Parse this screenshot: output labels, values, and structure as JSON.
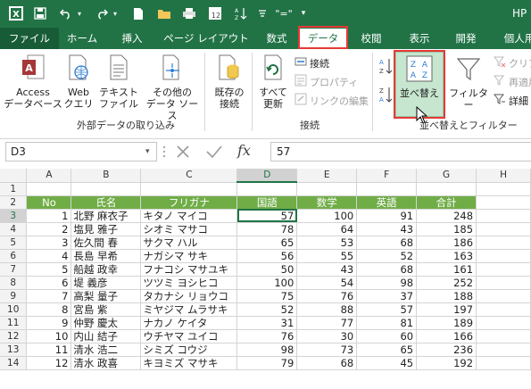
{
  "titlebar": {
    "title": "HP",
    "colors": {
      "brand": "#217346",
      "file_tab": "#185c37",
      "highlight": "#e53935"
    },
    "icons": [
      "excel-icon",
      "save-icon",
      "undo-icon",
      "redo-icon",
      "new-file-icon",
      "open-folder-icon",
      "print-icon",
      "calendar-icon",
      "sort-icon",
      "equals-icon",
      "customize-icon"
    ],
    "calendar_num": "12",
    "equals_label": "\"=\""
  },
  "tabs": [
    "ファイル",
    "ホーム",
    "挿入",
    "ページ レイアウト",
    "数式",
    "データ",
    "校閲",
    "表示",
    "開発",
    "個人用"
  ],
  "active_tab": "データ",
  "ribbon": {
    "external_data": {
      "access": [
        "Access",
        "データベース"
      ],
      "web": [
        "Web",
        "クエリ"
      ],
      "text": [
        "テキスト",
        "ファイル"
      ],
      "other": [
        "その他の",
        "データ ソース"
      ],
      "existing": [
        "既存の",
        "接続"
      ],
      "label": "外部データの取り込み"
    },
    "connections": {
      "refresh": [
        "すべて",
        "更新"
      ],
      "connections": "接続",
      "properties": "プロパティ",
      "edit_links": "リンクの編集",
      "label": "接続"
    },
    "sort_filter": {
      "sort": "並べ替え",
      "filter": "フィルター",
      "clear": "クリア",
      "reapply": "再適用",
      "advanced": "詳細",
      "label": "並べ替えとフィルター"
    }
  },
  "formula_bar": {
    "name_box": "D3",
    "fx": "fx",
    "value": "57"
  },
  "sheet": {
    "columns": [
      "A",
      "B",
      "C",
      "D",
      "E",
      "F",
      "G",
      "H"
    ],
    "selected_column": "D",
    "selected_row": 3,
    "header": [
      "No",
      "氏名",
      "フリガナ",
      "国語",
      "数学",
      "英語",
      "合計"
    ],
    "rows": [
      [
        "1",
        "北野 麻衣子",
        "キタノ マイコ",
        "57",
        "100",
        "91",
        "248"
      ],
      [
        "2",
        "塩見 雅子",
        "シオミ マサコ",
        "78",
        "64",
        "43",
        "185"
      ],
      [
        "3",
        "佐久間 春",
        "サクマ ハル",
        "65",
        "53",
        "68",
        "186"
      ],
      [
        "4",
        "長島 早希",
        "ナガシマ サキ",
        "56",
        "55",
        "52",
        "163"
      ],
      [
        "5",
        "船越 政幸",
        "フナコシ マサユキ",
        "50",
        "43",
        "68",
        "161"
      ],
      [
        "6",
        "堤 義彦",
        "ツツミ ヨシヒコ",
        "100",
        "54",
        "98",
        "252"
      ],
      [
        "7",
        "高梨 量子",
        "タカナシ リョウコ",
        "75",
        "76",
        "37",
        "188"
      ],
      [
        "8",
        "宮島 紫",
        "ミヤジマ ムラサキ",
        "52",
        "88",
        "57",
        "197"
      ],
      [
        "9",
        "仲野 慶太",
        "ナカノ ケイタ",
        "31",
        "77",
        "81",
        "189"
      ],
      [
        "10",
        "内山 結子",
        "ウチヤマ ユイコ",
        "76",
        "30",
        "60",
        "166"
      ],
      [
        "11",
        "清水 浩二",
        "シミズ コウジ",
        "98",
        "73",
        "65",
        "236"
      ],
      [
        "12",
        "清水 政喜",
        "キヨミズ マサキ",
        "79",
        "68",
        "45",
        "192"
      ]
    ]
  }
}
